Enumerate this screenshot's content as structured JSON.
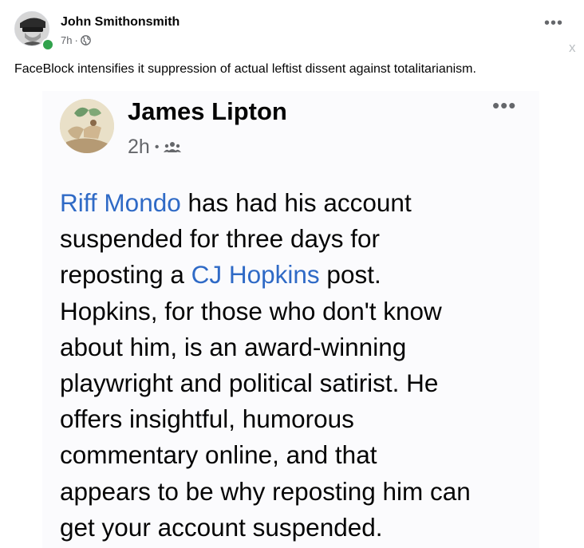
{
  "outer_post": {
    "author": "John Smithonsmith",
    "time": "7h",
    "dot": "·",
    "more": "•••",
    "close": "x",
    "caption": "FaceBlock intensifies it suppression of actual leftist dissent against totalitarianism."
  },
  "embedded_post": {
    "author": "James Lipton",
    "time": "2h",
    "dot": "•",
    "more": "•••",
    "body": {
      "link1": "Riff Mondo",
      "text1": " has had his account",
      "line2": "suspended for three days for",
      "text3a": "reposting a ",
      "link2": "CJ Hopkins",
      "text3b": " post.",
      "line4": "Hopkins, for those who don't know",
      "line5": "about him, is an award-winning",
      "line6": "playwright and political satirist. He",
      "line7": "offers insightful, humorous",
      "line8": "commentary online, and that",
      "line9": "appears to be why reposting him can",
      "line10": "get your account suspended."
    }
  },
  "colors": {
    "link": "#2f6ac6",
    "online": "#31a24c",
    "meta": "#65676b"
  },
  "icons": [
    "globe-icon",
    "friends-icon",
    "more-icon",
    "close-icon"
  ]
}
